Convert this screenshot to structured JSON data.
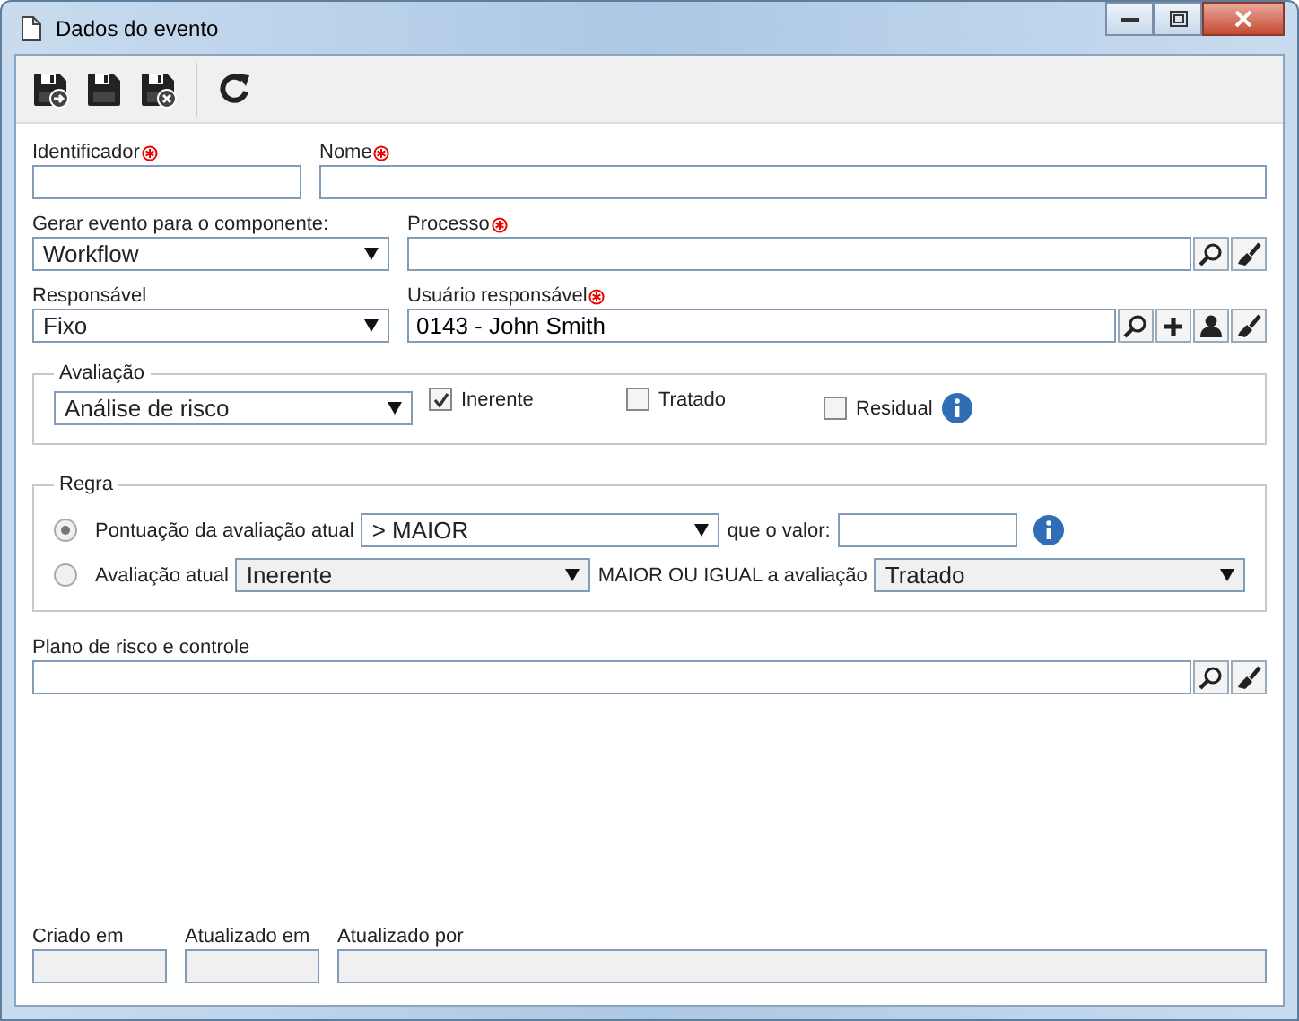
{
  "window": {
    "title": "Dados do evento"
  },
  "toolbar": [
    {
      "kind": "save-new"
    },
    {
      "kind": "save"
    },
    {
      "kind": "save-close"
    },
    {
      "kind": "refresh"
    }
  ],
  "row1": [
    {
      "label": "Identificador",
      "required": true
    },
    {
      "label": "Nome",
      "required": true
    }
  ],
  "componente": {
    "label": "Gerar evento para o componente:",
    "value": "Workflow"
  },
  "processo": {
    "label": "Processo",
    "required": true,
    "actions": [
      {
        "kind": "search"
      },
      {
        "kind": "clear"
      }
    ]
  },
  "responsavel": {
    "label": "Responsável",
    "value": "Fixo"
  },
  "usuario": {
    "label": "Usuário responsável",
    "required": true,
    "value": "0143 - John Smith",
    "actions": [
      {
        "kind": "search"
      },
      {
        "kind": "add"
      },
      {
        "kind": "user"
      },
      {
        "kind": "clear"
      }
    ]
  },
  "avaliacao": {
    "legend": "Avaliação",
    "value": "Análise de risco",
    "checks": [
      {
        "label": "Inerente",
        "checked": true
      },
      {
        "label": "Tratado",
        "checked": false
      },
      {
        "label": "Residual",
        "checked": false
      }
    ]
  },
  "regra": {
    "legend": "Regra",
    "options": [
      {
        "label": "Pontuação da avaliação atual",
        "selected": true,
        "select": "> MAIOR",
        "middle": "que o valor:",
        "kind": "value"
      },
      {
        "label": "Avaliação atual",
        "selected": false,
        "select": "Inerente",
        "middle": "MAIOR OU IGUAL a avaliação",
        "select2": "Tratado",
        "kind": "compare"
      }
    ]
  },
  "plano": {
    "label": "Plano de risco e controle",
    "actions": [
      {
        "kind": "search"
      },
      {
        "kind": "clear"
      }
    ]
  },
  "footer": [
    {
      "label": "Criado em"
    },
    {
      "label": "Atualizado em"
    },
    {
      "label": "Atualizado por"
    }
  ]
}
